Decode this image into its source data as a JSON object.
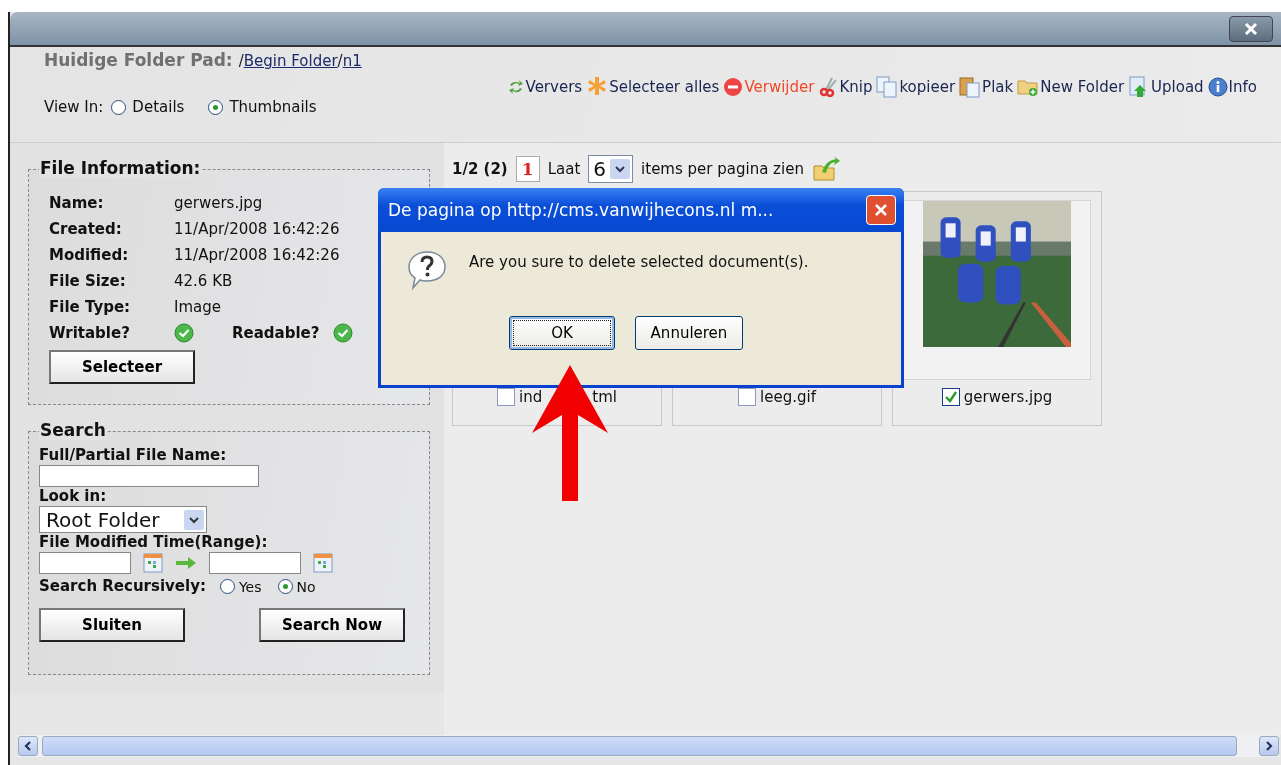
{
  "header": {
    "label": "Huidige Folder Pad:",
    "separator": "/",
    "path": [
      {
        "text": "Begin Folder"
      },
      {
        "text": "n1"
      }
    ]
  },
  "toolbar": [
    {
      "kind": "refresh",
      "label": "Ververs",
      "danger": false
    },
    {
      "kind": "select-all",
      "label": "Selecteer alles",
      "danger": false
    },
    {
      "kind": "delete",
      "label": "Verwijder",
      "danger": true
    },
    {
      "kind": "cut",
      "label": "Knip",
      "danger": false
    },
    {
      "kind": "copy",
      "label": "kopieer",
      "danger": false
    },
    {
      "kind": "paste",
      "label": "Plak",
      "danger": false
    },
    {
      "kind": "new-folder",
      "label": "New Folder",
      "danger": false
    },
    {
      "kind": "upload",
      "label": "Upload",
      "danger": false
    },
    {
      "kind": "info",
      "label": "Info",
      "danger": false
    }
  ],
  "view": {
    "label": "View In:",
    "options": [
      {
        "label": "Details",
        "selected": false
      },
      {
        "label": "Thumbnails",
        "selected": true
      }
    ]
  },
  "file_info": {
    "title": "File Information:",
    "rows": [
      {
        "label": "Name:",
        "value": "gerwers.jpg"
      },
      {
        "label": "Created:",
        "value": "11/Apr/2008 16:42:26"
      },
      {
        "label": "Modified:",
        "value": "11/Apr/2008 16:42:26"
      },
      {
        "label": "File Size:",
        "value": "42.6 KB"
      },
      {
        "label": "File Type:",
        "value": "Image"
      }
    ],
    "flags": [
      {
        "label": "Writable?",
        "on": true
      },
      {
        "label": "Readable?",
        "on": true
      }
    ],
    "button": "Selecteer"
  },
  "search": {
    "title": "Search",
    "name_label": "Full/Partial File Name:",
    "look_in_label": "Look in:",
    "look_in": "Root Folder",
    "time_label": "File Modified Time(Range):",
    "recursive_label": "Search Recursively:",
    "recursive_options": [
      {
        "label": "Yes",
        "selected": false
      },
      {
        "label": "No",
        "selected": true
      }
    ],
    "buttons": [
      "Sluiten",
      "Search Now"
    ]
  },
  "pager": {
    "position": "1/2 (2)",
    "page": "1",
    "show_label": "Laat",
    "per_page": "6",
    "per_page_label": "items per pagina zien"
  },
  "thumbnails": [
    {
      "name_start": "ind",
      "name_end": "tml",
      "checked": false
    },
    {
      "name": "leeg.gif",
      "checked": false
    },
    {
      "name": "gerwers.jpg",
      "checked": true,
      "kind": "picture"
    }
  ],
  "dialog": {
    "title": "De pagina op http://cms.vanwijhecons.nl m...",
    "message": "Are you sure to delete selected document(s).",
    "buttons": [
      {
        "label": "OK",
        "selected": true
      },
      {
        "label": "Annuleren",
        "selected": false
      }
    ]
  }
}
